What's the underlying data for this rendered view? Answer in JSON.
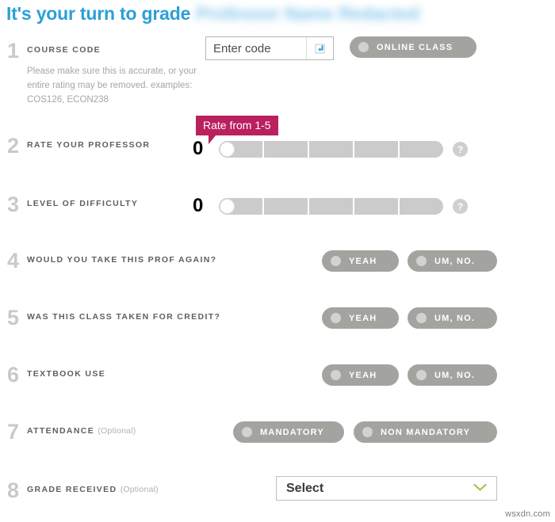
{
  "header": {
    "title_prefix": "It's your turn to grade",
    "professor_name": "Professor Name Redacted"
  },
  "online_class_button": {
    "label": "ONLINE CLASS"
  },
  "questions": [
    {
      "number": "1",
      "label": "COURSE CODE",
      "helper": "Please make sure this is accurate, or your entire rating may be removed. examples: COS126, ECON238",
      "input_value": "",
      "input_placeholder": "Enter code"
    },
    {
      "number": "2",
      "label": "RATE YOUR PROFESSOR",
      "value": "0",
      "tooltip": "Rate from 1-5",
      "help": "?"
    },
    {
      "number": "3",
      "label": "LEVEL OF DIFFICULTY",
      "value": "0",
      "help": "?"
    },
    {
      "number": "4",
      "label": "WOULD YOU TAKE THIS PROF AGAIN?",
      "yes_label": "YEAH",
      "no_label": "UM, NO."
    },
    {
      "number": "5",
      "label": "WAS THIS CLASS TAKEN FOR CREDIT?",
      "yes_label": "YEAH",
      "no_label": "UM, NO."
    },
    {
      "number": "6",
      "label": "TEXTBOOK USE",
      "yes_label": "YEAH",
      "no_label": "UM, NO."
    },
    {
      "number": "7",
      "label": "ATTENDANCE",
      "optional": "(Optional)",
      "yes_label": "MANDATORY",
      "no_label": "NON MANDATORY"
    },
    {
      "number": "8",
      "label": "GRADE RECEIVED",
      "optional": "(Optional)",
      "select_value": "Select"
    }
  ],
  "icons": {
    "code_input": "enter-arrow-icon",
    "select_chevron": "chevron-down-icon",
    "help": "question-mark-icon"
  },
  "colors": {
    "heading_blue": "#2b9fd8",
    "tooltip_crimson": "#ba1f5e",
    "pill_gray": "#a3a3a0",
    "track_gray": "#cbcbcb",
    "chevron_green": "#a8c04a",
    "input_icon_blue": "#2b9fd8"
  },
  "watermark": "wsxdn.com"
}
